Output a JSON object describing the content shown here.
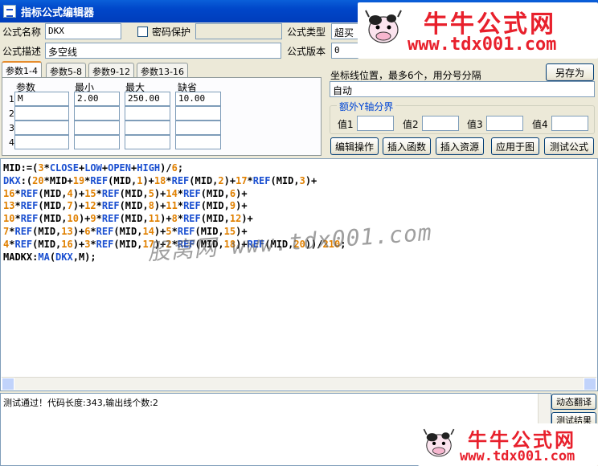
{
  "window": {
    "title": "指标公式编辑器"
  },
  "header": {
    "name_label": "公式名称",
    "name_value": "DKX",
    "password_label": "密码保护",
    "password_value": "",
    "type_label": "公式类型",
    "type_value": "超买",
    "desc_label": "公式描述",
    "desc_value": "多空线",
    "version_label": "公式版本",
    "version_value": "0"
  },
  "tabs": [
    "参数1-4",
    "参数5-8",
    "参数9-12",
    "参数13-16"
  ],
  "params": {
    "headers": [
      "参数",
      "最小",
      "最大",
      "缺省"
    ],
    "rows": [
      {
        "num": "1",
        "name": "M",
        "min": "2.00",
        "max": "250.00",
        "default": "10.00"
      },
      {
        "num": "2",
        "name": "",
        "min": "",
        "max": "",
        "default": ""
      },
      {
        "num": "3",
        "name": "",
        "min": "",
        "max": "",
        "default": ""
      },
      {
        "num": "4",
        "name": "",
        "min": "",
        "max": "",
        "default": ""
      }
    ]
  },
  "right_panel": {
    "save_as_label": "另存为",
    "axis_label": "坐标线位置，最多6个，用分号分隔",
    "axis_value": "自动",
    "extra_axis_title": "额外Y轴分界",
    "values": [
      "值1",
      "值2",
      "值3",
      "值4"
    ],
    "buttons": [
      "编辑操作",
      "插入函数",
      "插入资源",
      "应用于图",
      "测试公式"
    ]
  },
  "editor": {
    "lines": [
      [
        [
          "id",
          "MID:=("
        ],
        [
          "num",
          "3"
        ],
        [
          "op",
          "*"
        ],
        [
          "fn",
          "CLOSE"
        ],
        [
          "op",
          "+"
        ],
        [
          "fn",
          "LOW"
        ],
        [
          "op",
          "+"
        ],
        [
          "fn",
          "OPEN"
        ],
        [
          "op",
          "+"
        ],
        [
          "fn",
          "HIGH"
        ],
        [
          "op",
          ")/"
        ],
        [
          "num",
          "6"
        ],
        [
          "op",
          ";"
        ]
      ],
      [
        [
          "out",
          "DKX"
        ],
        [
          "op",
          ":("
        ],
        [
          "num",
          "20"
        ],
        [
          "op",
          "*MID+"
        ],
        [
          "num",
          "19"
        ],
        [
          "op",
          "*"
        ],
        [
          "fn",
          "REF"
        ],
        [
          "op",
          "(MID,"
        ],
        [
          "num",
          "1"
        ],
        [
          "op",
          ")+"
        ],
        [
          "num",
          "18"
        ],
        [
          "op",
          "*"
        ],
        [
          "fn",
          "REF"
        ],
        [
          "op",
          "(MID,"
        ],
        [
          "num",
          "2"
        ],
        [
          "op",
          ")+"
        ],
        [
          "num",
          "17"
        ],
        [
          "op",
          "*"
        ],
        [
          "fn",
          "REF"
        ],
        [
          "op",
          "(MID,"
        ],
        [
          "num",
          "3"
        ],
        [
          "op",
          ")+"
        ]
      ],
      [
        [
          "num",
          "16"
        ],
        [
          "op",
          "*"
        ],
        [
          "fn",
          "REF"
        ],
        [
          "op",
          "(MID,"
        ],
        [
          "num",
          "4"
        ],
        [
          "op",
          ")+"
        ],
        [
          "num",
          "15"
        ],
        [
          "op",
          "*"
        ],
        [
          "fn",
          "REF"
        ],
        [
          "op",
          "(MID,"
        ],
        [
          "num",
          "5"
        ],
        [
          "op",
          ")+"
        ],
        [
          "num",
          "14"
        ],
        [
          "op",
          "*"
        ],
        [
          "fn",
          "REF"
        ],
        [
          "op",
          "(MID,"
        ],
        [
          "num",
          "6"
        ],
        [
          "op",
          ")+"
        ]
      ],
      [
        [
          "num",
          "13"
        ],
        [
          "op",
          "*"
        ],
        [
          "fn",
          "REF"
        ],
        [
          "op",
          "(MID,"
        ],
        [
          "num",
          "7"
        ],
        [
          "op",
          ")+"
        ],
        [
          "num",
          "12"
        ],
        [
          "op",
          "*"
        ],
        [
          "fn",
          "REF"
        ],
        [
          "op",
          "(MID,"
        ],
        [
          "num",
          "8"
        ],
        [
          "op",
          ")+"
        ],
        [
          "num",
          "11"
        ],
        [
          "op",
          "*"
        ],
        [
          "fn",
          "REF"
        ],
        [
          "op",
          "(MID,"
        ],
        [
          "num",
          "9"
        ],
        [
          "op",
          ")+"
        ]
      ],
      [
        [
          "num",
          "10"
        ],
        [
          "op",
          "*"
        ],
        [
          "fn",
          "REF"
        ],
        [
          "op",
          "(MID,"
        ],
        [
          "num",
          "10"
        ],
        [
          "op",
          ")+"
        ],
        [
          "num",
          "9"
        ],
        [
          "op",
          "*"
        ],
        [
          "fn",
          "REF"
        ],
        [
          "op",
          "(MID,"
        ],
        [
          "num",
          "11"
        ],
        [
          "op",
          ")+"
        ],
        [
          "num",
          "8"
        ],
        [
          "op",
          "*"
        ],
        [
          "fn",
          "REF"
        ],
        [
          "op",
          "(MID,"
        ],
        [
          "num",
          "12"
        ],
        [
          "op",
          ")+"
        ]
      ],
      [
        [
          "num",
          "7"
        ],
        [
          "op",
          "*"
        ],
        [
          "fn",
          "REF"
        ],
        [
          "op",
          "(MID,"
        ],
        [
          "num",
          "13"
        ],
        [
          "op",
          ")+"
        ],
        [
          "num",
          "6"
        ],
        [
          "op",
          "*"
        ],
        [
          "fn",
          "REF"
        ],
        [
          "op",
          "(MID,"
        ],
        [
          "num",
          "14"
        ],
        [
          "op",
          ")+"
        ],
        [
          "num",
          "5"
        ],
        [
          "op",
          "*"
        ],
        [
          "fn",
          "REF"
        ],
        [
          "op",
          "(MID,"
        ],
        [
          "num",
          "15"
        ],
        [
          "op",
          ")+"
        ]
      ],
      [
        [
          "num",
          "4"
        ],
        [
          "op",
          "*"
        ],
        [
          "fn",
          "REF"
        ],
        [
          "op",
          "(MID,"
        ],
        [
          "num",
          "16"
        ],
        [
          "op",
          ")+"
        ],
        [
          "num",
          "3"
        ],
        [
          "op",
          "*"
        ],
        [
          "fn",
          "REF"
        ],
        [
          "op",
          "(MID,"
        ],
        [
          "num",
          "17"
        ],
        [
          "op",
          ")+"
        ],
        [
          "num",
          "2"
        ],
        [
          "op",
          "*"
        ],
        [
          "fn",
          "REF"
        ],
        [
          "op",
          "(MID,"
        ],
        [
          "num",
          "18"
        ],
        [
          "op",
          ")+"
        ],
        [
          "fn",
          "REF"
        ],
        [
          "op",
          "(MID,"
        ],
        [
          "num",
          "20"
        ],
        [
          "op",
          "))/"
        ],
        [
          "num",
          "210"
        ],
        [
          "op",
          ";"
        ]
      ],
      [
        [
          "id",
          "MADKX:"
        ],
        [
          "fn",
          "MA"
        ],
        [
          "op",
          "("
        ],
        [
          "out",
          "DKX"
        ],
        [
          "op",
          ",M);"
        ]
      ]
    ]
  },
  "watermark": {
    "text": "股窝网 www.tdx001.com"
  },
  "status": {
    "text": "测试通过！代码长度:343,输出线个数:2"
  },
  "side_buttons": {
    "translate_label": "动态翻译",
    "result_label": "测试结果"
  },
  "logo": {
    "brand": "牛牛公式网",
    "url": "www.tdx001.com"
  }
}
